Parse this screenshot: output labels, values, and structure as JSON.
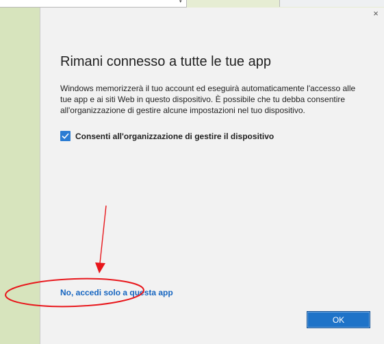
{
  "dialog": {
    "close_label": "×",
    "title": "Rimani connesso a tutte le tue app",
    "description": "Windows memorizzerà il tuo account ed eseguirà automaticamente l'accesso alle tue app e ai siti Web in questo dispositivo. È possibile che tu debba consentire all'organizzazione di gestire alcune impostazioni nel tuo dispositivo.",
    "checkbox": {
      "label": "Consenti all'organizzazione di gestire il dispositivo",
      "checked": true
    },
    "local_link": "No, accedi solo a questa app",
    "ok_label": "OK"
  },
  "background": {
    "dropdown_icon": "▾"
  },
  "colors": {
    "accent": "#2b7cd3",
    "link": "#1565c0",
    "ok_button": "#1e73c8",
    "annotation": "#e8161b",
    "side_panel": "#d7e4bd",
    "dialog_bg": "#f2f2f2"
  },
  "icons": {
    "close": "close-icon",
    "checkbox": "checkmark-icon",
    "dropdown": "chevron-down-icon"
  }
}
